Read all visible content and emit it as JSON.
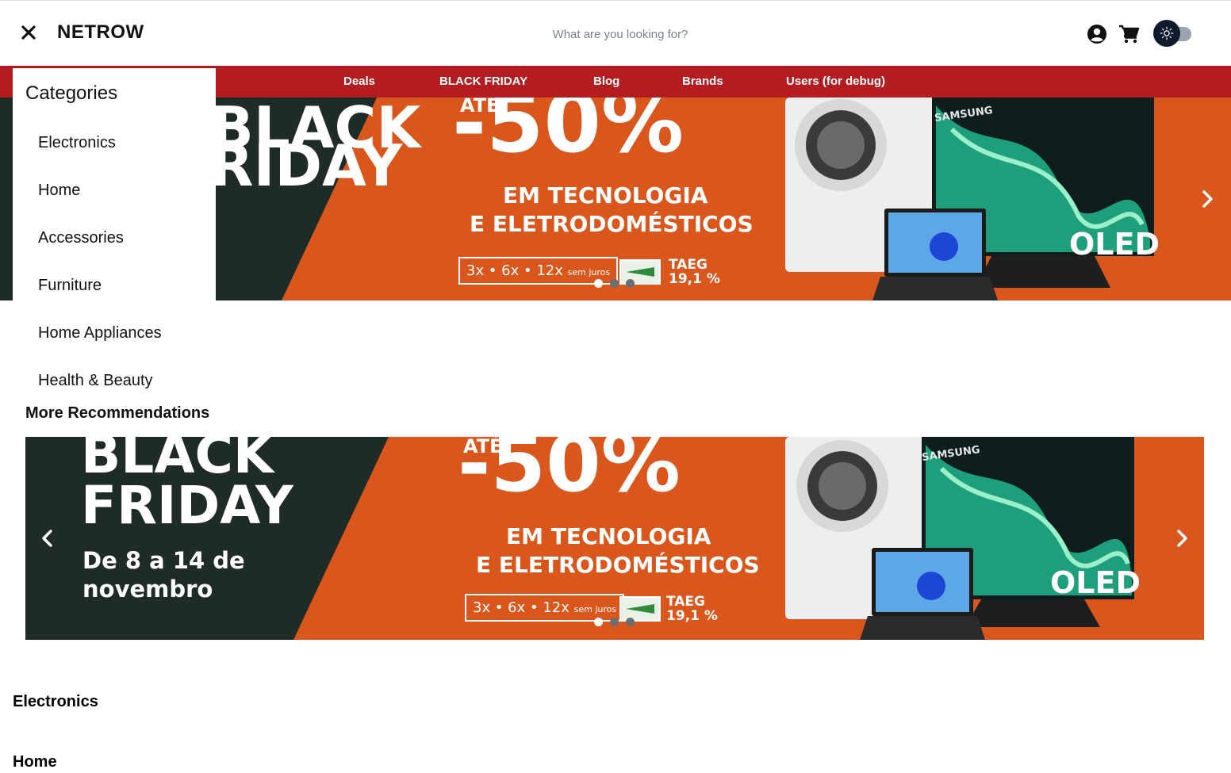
{
  "header": {
    "brand": "NETROW",
    "search_placeholder": "What are you looking for?",
    "icons": [
      "close-icon",
      "user-icon",
      "cart-icon",
      "sun-icon"
    ]
  },
  "nav": {
    "items": [
      {
        "label": "Deals"
      },
      {
        "label": "BLACK FRIDAY"
      },
      {
        "label": "Blog"
      },
      {
        "label": "Brands"
      },
      {
        "label": "Users (for debug)"
      }
    ]
  },
  "categories_menu": {
    "title": "Categories",
    "items": [
      {
        "label": "Electronics"
      },
      {
        "label": "Home"
      },
      {
        "label": "Accessories"
      },
      {
        "label": "Furniture"
      },
      {
        "label": "Home Appliances"
      },
      {
        "label": "Health & Beauty"
      }
    ]
  },
  "banner": {
    "headline_1": "BLACK",
    "headline_2": "FRIDAY",
    "dates_1": "De 8 a 14 de",
    "dates_2": "novembro",
    "ate": "ATÉ",
    "discount": "-50%",
    "line_1": "EM TECNOLOGIA",
    "line_2": "E ELETRODOMÉSTICOS",
    "installments": "3x • 6x • 12x",
    "installments_suffix": "sem juros",
    "taeg_label": "TAEG",
    "taeg_value": "19,1 %",
    "tv_label": "OLED",
    "tv_brand": "SAMSUNG",
    "slides": 3,
    "active_slide": 1,
    "colors": {
      "orange": "#d9571c",
      "dark": "#1f2b26",
      "navbar": "#b31d22"
    }
  },
  "sections": {
    "recommendations": "More Recommendations",
    "electronics": "Electronics",
    "home": "Home"
  }
}
